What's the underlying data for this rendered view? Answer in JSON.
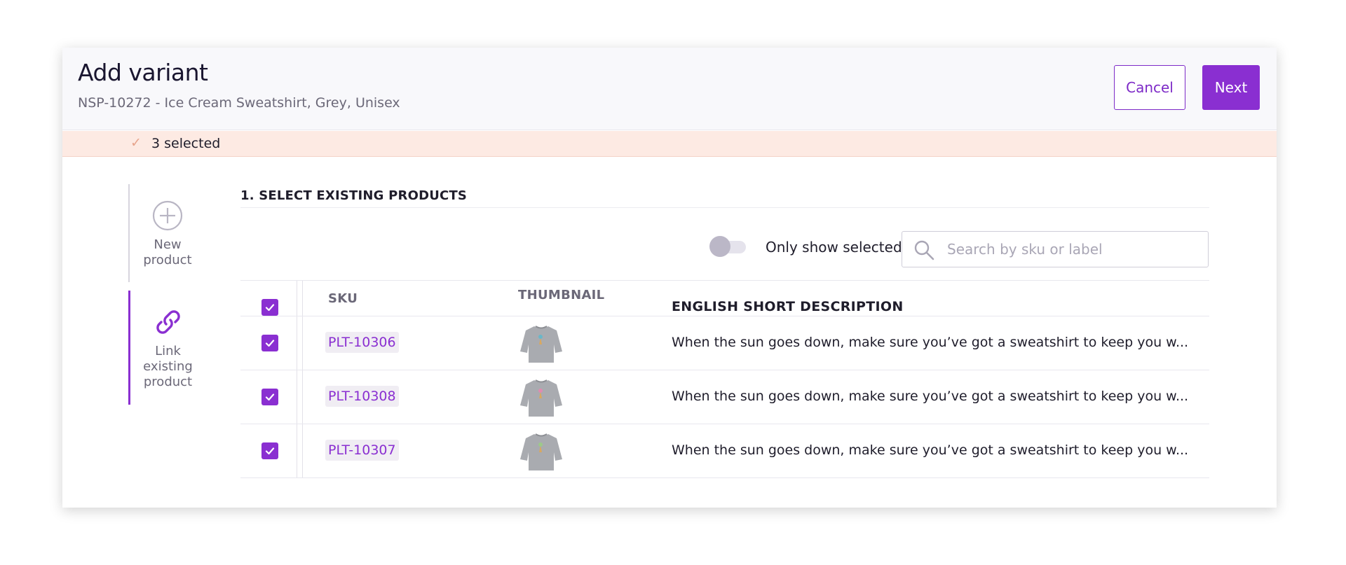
{
  "header": {
    "title": "Add variant",
    "subtitle": "NSP-10272 - Ice Cream Sweatshirt, Grey, Unisex",
    "cancel_label": "Cancel",
    "next_label": "Next"
  },
  "selection": {
    "text": "3 selected"
  },
  "steps": [
    {
      "label": "New product",
      "icon": "plus-circle-icon",
      "active": false
    },
    {
      "label": "Link existing product",
      "icon": "link-icon",
      "active": true
    }
  ],
  "section": {
    "title": "1. SELECT EXISTING PRODUCTS"
  },
  "filter": {
    "toggle_label": "Only show selected",
    "toggle_on": false,
    "search_placeholder": "Search by sku or label",
    "search_value": ""
  },
  "table": {
    "columns": [
      "SKU",
      "THUMBNAIL",
      "ENGLISH SHORT DESCRIPTION"
    ],
    "rows": [
      {
        "sku": "PLT-10306",
        "checked": true,
        "description": "When the sun goes down, make sure you’ve got a sweatshirt to keep you w..."
      },
      {
        "sku": "PLT-10308",
        "checked": true,
        "description": "When the sun goes down, make sure you’ve got a sweatshirt to keep you w..."
      },
      {
        "sku": "PLT-10307",
        "checked": true,
        "description": "When the sun goes down, make sure you’ve got a sweatshirt to keep you w..."
      }
    ]
  },
  "colors": {
    "accent": "#8a2fd1",
    "selection_bar": "#fdeae3",
    "header_bg": "#f8f8fb"
  }
}
